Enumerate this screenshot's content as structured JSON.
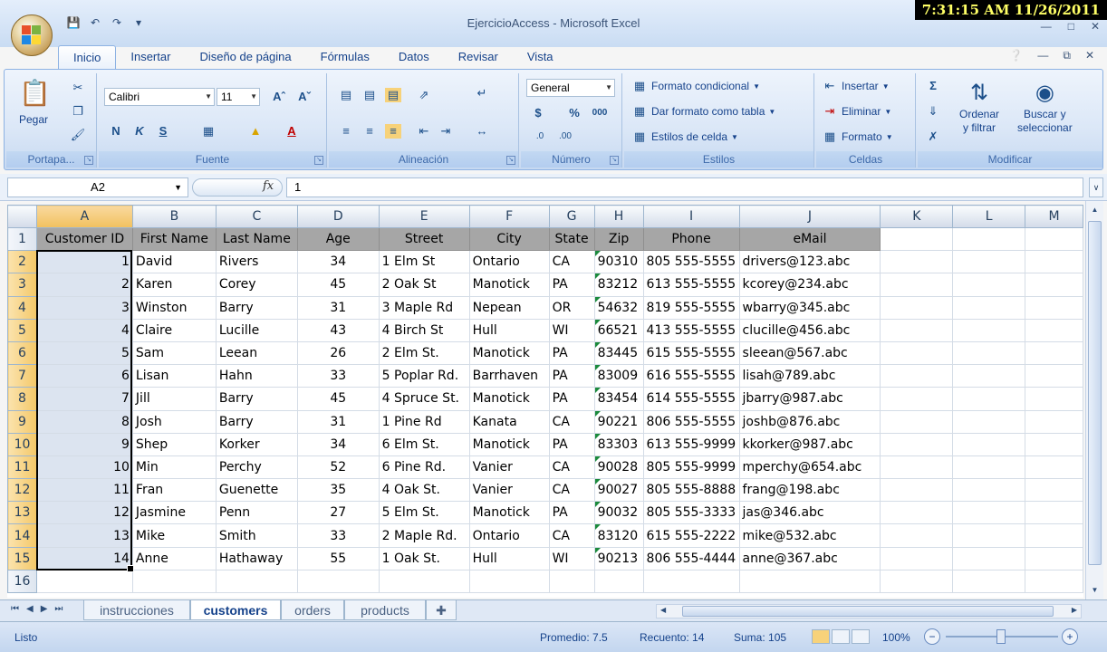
{
  "window": {
    "title": "EjercicioAccess - Microsoft Excel",
    "clock": "7:31:15 AM 11/26/2011"
  },
  "ribbon_tabs": [
    "Inicio",
    "Insertar",
    "Diseño de página",
    "Fórmulas",
    "Datos",
    "Revisar",
    "Vista"
  ],
  "ribbon": {
    "groups": {
      "portapapeles": "Portapa...",
      "fuente": "Fuente",
      "alineacion": "Alineación",
      "numero": "Número",
      "estilos": "Estilos",
      "celdas": "Celdas",
      "modificar": "Modificar"
    },
    "pegar": "Pegar",
    "font_name": "Calibri",
    "font_size": "11",
    "number_format": "General",
    "formato_condicional": "Formato condicional",
    "dar_formato_tabla": "Dar formato como tabla",
    "estilos_celda": "Estilos de celda",
    "insertar": "Insertar",
    "eliminar": "Eliminar",
    "formato": "Formato",
    "ordenar_1": "Ordenar",
    "ordenar_2": "y filtrar",
    "buscar_1": "Buscar y",
    "buscar_2": "seleccionar",
    "bold": "N",
    "italic": "K",
    "underline": "S"
  },
  "formula_bar": {
    "name_box": "A2",
    "fx": "fx",
    "value": "1"
  },
  "columns": [
    "A",
    "B",
    "C",
    "D",
    "E",
    "F",
    "G",
    "H",
    "I",
    "J",
    "K",
    "L",
    "M"
  ],
  "header_row": [
    "Customer ID",
    "First Name",
    "Last Name",
    "Age",
    "Street",
    "City",
    "State",
    "Zip",
    "Phone",
    "eMail"
  ],
  "rows": [
    [
      "1",
      "David",
      "Rivers",
      "34",
      "1 Elm St",
      "Ontario",
      "CA",
      "90310",
      "805 555-5555",
      "drivers@123.abc"
    ],
    [
      "2",
      "Karen",
      "Corey",
      "45",
      "2 Oak St",
      "Manotick",
      "PA",
      "83212",
      "613 555-5555",
      "kcorey@234.abc"
    ],
    [
      "3",
      "Winston",
      "Barry",
      "31",
      "3 Maple Rd",
      "Nepean",
      "OR",
      "54632",
      "819 555-5555",
      "wbarry@345.abc"
    ],
    [
      "4",
      "Claire",
      "Lucille",
      "43",
      "4 Birch St",
      "Hull",
      "WI",
      "66521",
      "413 555-5555",
      "clucille@456.abc"
    ],
    [
      "5",
      "Sam",
      "Leean",
      "26",
      "2 Elm St.",
      "Manotick",
      "PA",
      "83445",
      "615 555-5555",
      "sleean@567.abc"
    ],
    [
      "6",
      "Lisan",
      "Hahn",
      "33",
      "5 Poplar Rd.",
      "Barrhaven",
      "PA",
      "83009",
      "616 555-5555",
      "lisah@789.abc"
    ],
    [
      "7",
      "Jill",
      "Barry",
      "45",
      "4  Spruce St.",
      "Manotick",
      "PA",
      "83454",
      "614 555-5555",
      "jbarry@987.abc"
    ],
    [
      "8",
      "Josh",
      "Barry",
      "31",
      "1 Pine Rd",
      "Kanata",
      "CA",
      "90221",
      "806 555-5555",
      "joshb@876.abc"
    ],
    [
      "9",
      "Shep",
      "Korker",
      "34",
      "6 Elm St.",
      "Manotick",
      "PA",
      "83303",
      "613 555-9999",
      "kkorker@987.abc"
    ],
    [
      "10",
      "Min",
      "Perchy",
      "52",
      "6 Pine Rd.",
      "Vanier",
      "CA",
      "90028",
      "805 555-9999",
      "mperchy@654.abc"
    ],
    [
      "11",
      "Fran",
      "Guenette",
      "35",
      "4 Oak St.",
      "Vanier",
      "CA",
      "90027",
      "805 555-8888",
      "frang@198.abc"
    ],
    [
      "12",
      "Jasmine",
      "Penn",
      "27",
      "5 Elm St.",
      "Manotick",
      "PA",
      "90032",
      "805 555-3333",
      "jas@346.abc"
    ],
    [
      "13",
      "Mike",
      "Smith",
      "33",
      "2 Maple Rd.",
      "Ontario",
      "CA",
      "83120",
      "615 555-2222",
      "mike@532.abc"
    ],
    [
      "14",
      "Anne",
      "Hathaway",
      "55",
      "1 Oak St.",
      "Hull",
      "WI",
      "90213",
      "806 555-4444",
      "anne@367.abc"
    ]
  ],
  "row_numbers": [
    "1",
    "2",
    "3",
    "4",
    "5",
    "6",
    "7",
    "8",
    "9",
    "10",
    "11",
    "12",
    "13",
    "14",
    "15",
    "16"
  ],
  "sheet_tabs": [
    "instrucciones",
    "customers",
    "orders",
    "products"
  ],
  "active_sheet": "customers",
  "status": {
    "mode": "Listo",
    "promedio": "Promedio: 7.5",
    "recuento": "Recuento: 14",
    "suma": "Suma: 105",
    "zoom": "100%"
  },
  "colors": {
    "accent": "#15428b",
    "selected_header": "#f1c15f",
    "table_header_fill": "#a6a6a6"
  }
}
